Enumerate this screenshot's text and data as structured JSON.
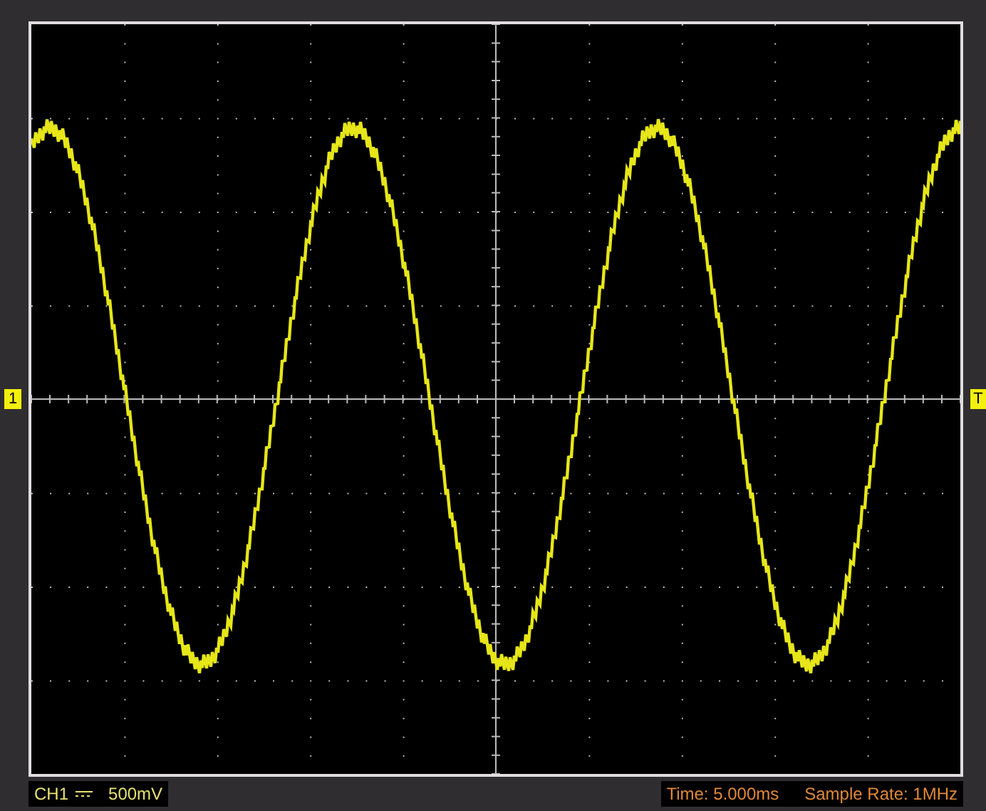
{
  "markers": {
    "channel": "1",
    "trigger": "T"
  },
  "channel_info": {
    "name": "CH1",
    "scale": "500mV"
  },
  "acquisition": {
    "time": "Time: 5.000ms",
    "sample_rate": "Sample Rate: 1MHz"
  }
}
